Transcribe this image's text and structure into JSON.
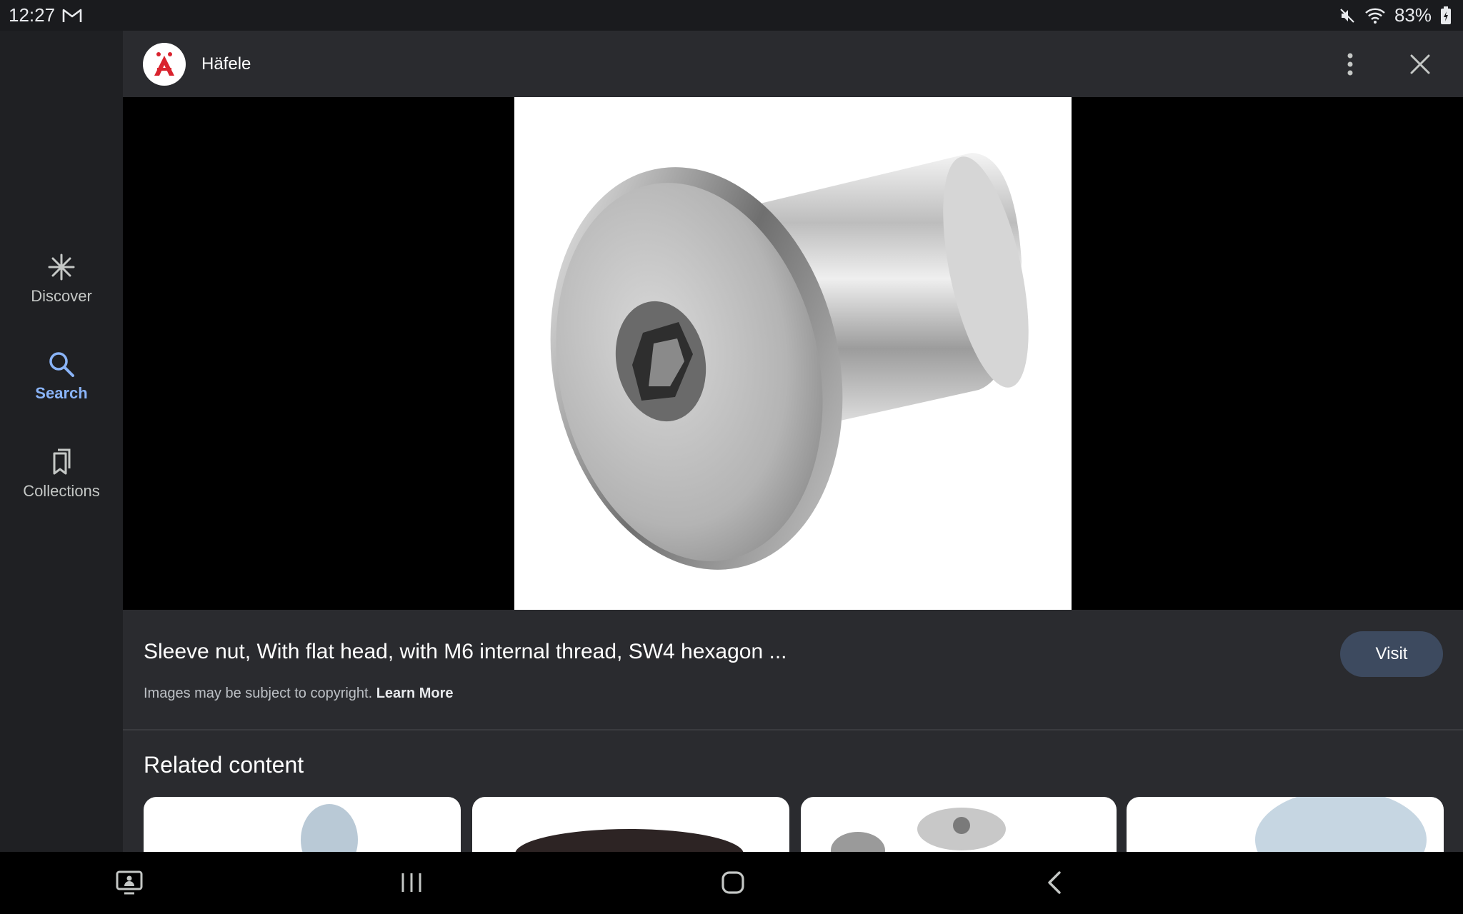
{
  "status_bar": {
    "time": "12:27",
    "mail_icon": "gmail-icon",
    "battery_percent": "83%"
  },
  "nav_rail": {
    "items": [
      {
        "label": "Discover",
        "icon": "asterisk-icon",
        "active": false
      },
      {
        "label": "Search",
        "icon": "search-icon",
        "active": true
      },
      {
        "label": "Collections",
        "icon": "bookmark-icon",
        "active": false
      }
    ]
  },
  "header": {
    "source_name": "Häfele",
    "logo_letter": "A"
  },
  "result": {
    "title": "Sleeve nut, With flat head, with M6 internal thread, SW4 hexagon ...",
    "copyright_text": "Images may be subject to copyright.",
    "learn_more": "Learn More",
    "visit_label": "Visit"
  },
  "related": {
    "title": "Related content"
  },
  "colors": {
    "accent": "#8ab4f8",
    "brand_red": "#d9232e",
    "visit_button": "#3d4a5f"
  }
}
